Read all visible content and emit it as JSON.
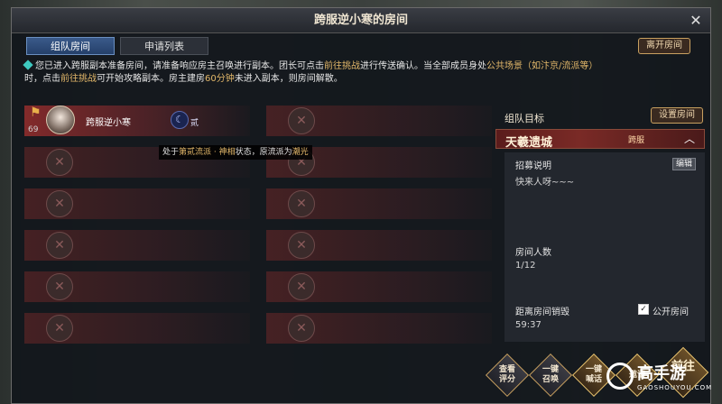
{
  "window": {
    "title": "跨服逆小寒的房间",
    "close_label": "✕"
  },
  "tabs": [
    {
      "label": "组队房间",
      "active": true
    },
    {
      "label": "申请列表",
      "active": false
    }
  ],
  "leave_button": "离开房间",
  "notice": {
    "part1": "您已进入跨服副本准备房间，请准备响应房主召唤进行副本。团长可点击",
    "hl1": "前往挑战",
    "part2": "进行传送确认。当全部成员身处",
    "hl2": "公共场景（如汴京/流派等）",
    "part3": "时，点击",
    "hl3": "前往挑战",
    "part4": "可开始攻略副本。房主建房",
    "hl4": "60分钟",
    "part5": "未进入副本，则房间解散。"
  },
  "member": {
    "name": "跨服逆小寒",
    "level": "69",
    "sect_char": "贰"
  },
  "tooltip": {
    "prefix": "处于",
    "sect": "第贰流派 · 神相",
    "mid": "状态，原流派为",
    "orig": "潮光"
  },
  "right_panel": {
    "title": "组队目标",
    "setup_button": "设置房间",
    "target_name": "天羲遗城",
    "target_tag": "跨服",
    "recruit_label": "招募说明",
    "edit_button": "编辑",
    "recruit_text": "快来人呀~~~",
    "count_label": "房间人数",
    "count_value": "1/12",
    "destroy_label": "距离房间销毁",
    "destroy_value": "59:37",
    "public_label": "公开房间",
    "public_checked": true
  },
  "actions": [
    {
      "label": "查看\n评分"
    },
    {
      "label": "一键\n召唤"
    },
    {
      "label": "一键\n喊话"
    },
    {
      "label": "邀请"
    },
    {
      "label": "前往"
    }
  ],
  "watermark": {
    "text": "高手游",
    "sub": "GAOSHOUYOU.COM"
  },
  "icons": {
    "close": "close-icon",
    "empty_slot": "crossed-swords-icon",
    "leader": "leader-flag-icon",
    "sect": "sect-icon"
  }
}
